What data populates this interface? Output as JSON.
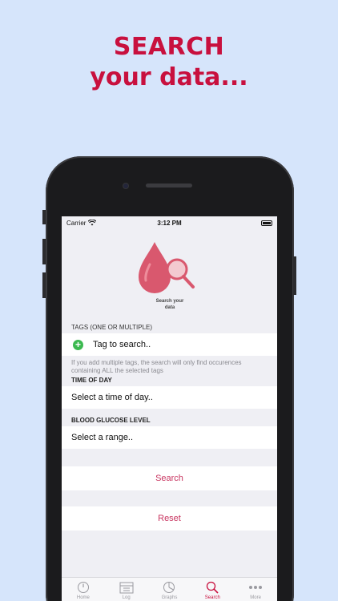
{
  "headline": {
    "line1": "SEARCH",
    "line2": "your data..."
  },
  "status_bar": {
    "carrier": "Carrier",
    "time": "3:12 PM"
  },
  "logo": {
    "caption_line1": "Search your",
    "caption_line2": "data"
  },
  "tags_section": {
    "header": "TAGS (ONE OR MULTIPLE)",
    "placeholder": "Tag to search..",
    "note": "If you add multiple tags, the search will only find occurences containing ALL the selected tags"
  },
  "time_of_day": {
    "header": "TIME OF DAY",
    "value": "Select a time of day.."
  },
  "blood_glucose": {
    "header": "BLOOD GLUCOSE LEVEL",
    "value": "Select a range.."
  },
  "actions": {
    "search": "Search",
    "reset": "Reset"
  },
  "tabs": [
    {
      "label": "Home",
      "icon": "gauge-icon"
    },
    {
      "label": "Log",
      "icon": "calendar-icon"
    },
    {
      "label": "Graphs",
      "icon": "pie-chart-icon"
    },
    {
      "label": "Search",
      "icon": "search-icon"
    },
    {
      "label": "More",
      "icon": "ellipsis-icon"
    }
  ],
  "colors": {
    "accent": "#c8103e",
    "background": "#d6e5fb",
    "add": "#3cb950"
  }
}
